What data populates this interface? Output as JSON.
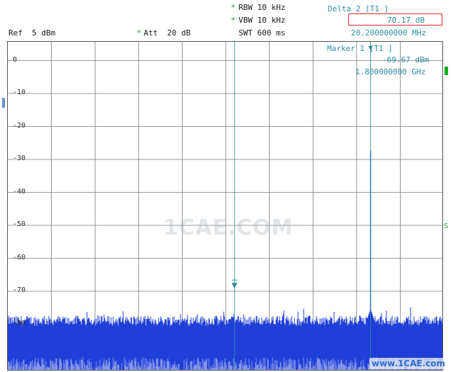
{
  "header": {
    "rbw": "RBW 10 kHz",
    "vbw": "VBW 10 kHz",
    "swt": "SWT 600 ms",
    "ref": "Ref  5 dBm",
    "att": "Att  20 dB",
    "asterisk": "*"
  },
  "delta_marker": {
    "title": "Delta 2 [T1 ]",
    "value": "70.17 dB",
    "freq": "20.200000000 MHz"
  },
  "marker1": {
    "title": "Marker 1 [T1 ]",
    "value": "-69.67 dBm",
    "freq": "1.800000000 GHz"
  },
  "side": {
    "s_label": "S"
  },
  "watermark": {
    "center": "1CAE.COM",
    "corner": "www.1CAE.com"
  },
  "colors": {
    "trace": "#1f3fd8",
    "marker": "#2c8fa0",
    "grid": "#7a7a7a",
    "highlight": "#e0262a"
  },
  "chart_data": {
    "type": "line",
    "ylabels": [
      "0",
      "-10",
      "-20",
      "-30",
      "-40",
      "-50",
      "-60",
      "-70",
      "-80"
    ],
    "ylim": [
      -95,
      5
    ],
    "noise_floor_dbm": -85,
    "peaks": [
      {
        "name": "Marker 1",
        "x_fraction": 0.832,
        "level_dbm": -28,
        "shoulder_dbm": -76
      },
      {
        "name": "Delta 2",
        "x_fraction": 0.52,
        "level_dbm": -69
      }
    ],
    "markers": [
      {
        "label": "1",
        "x_fraction": 0.832
      },
      {
        "label": "2",
        "x_fraction": 0.52
      }
    ]
  }
}
